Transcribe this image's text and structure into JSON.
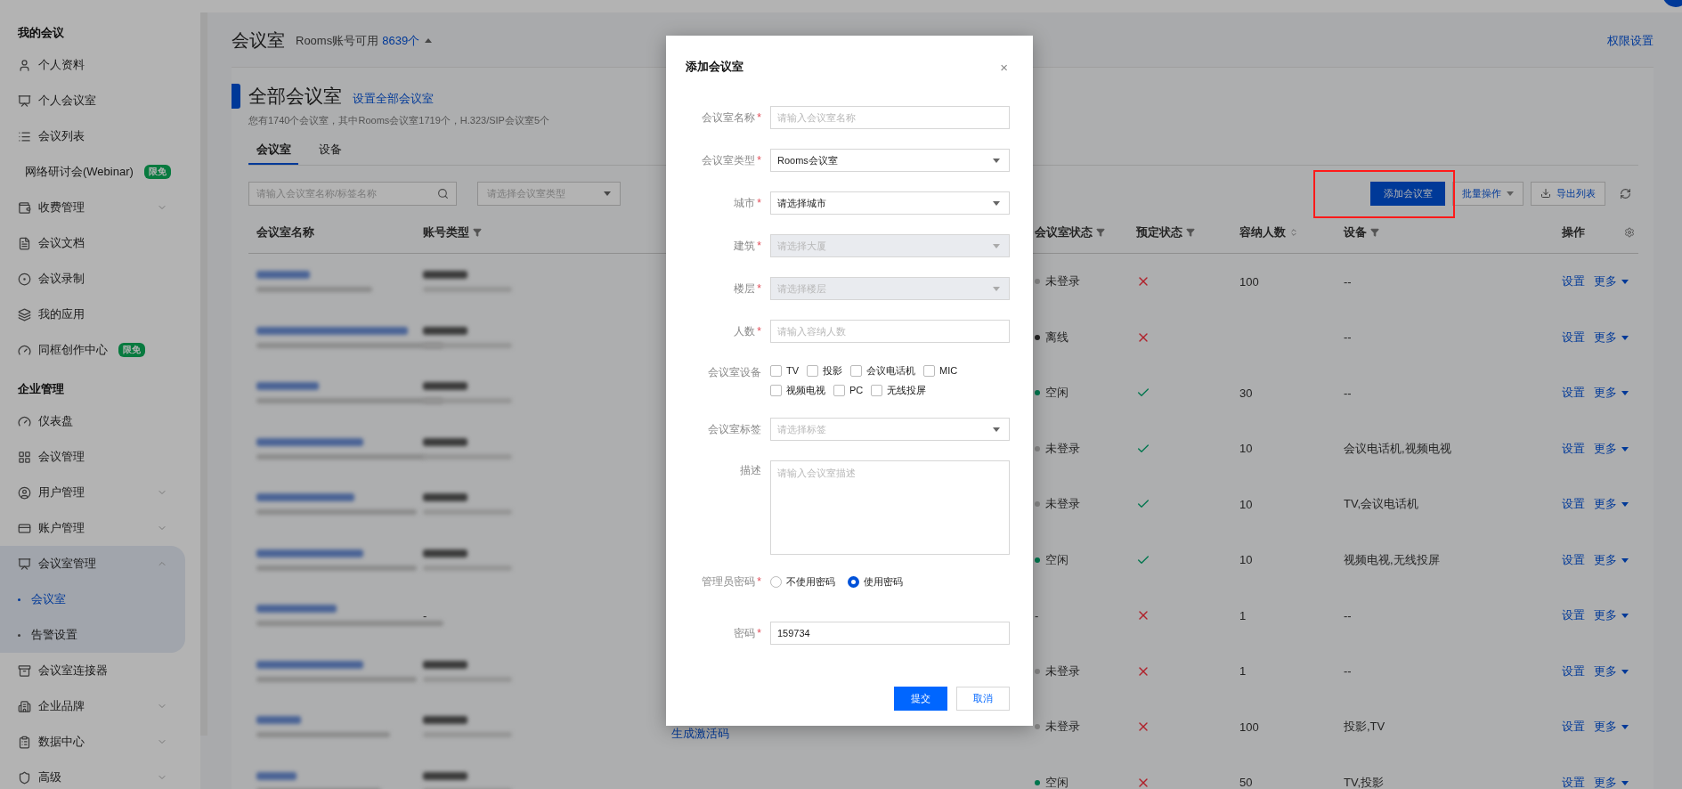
{
  "header": {
    "title": "会议室",
    "quota_label": "Rooms账号可用",
    "quota_value": "8639个",
    "permission_link": "权限设置"
  },
  "sidebar": {
    "sections": [
      {
        "title": "我的会议",
        "items": [
          {
            "label": "个人资料"
          },
          {
            "label": "个人会议室"
          },
          {
            "label": "会议列表"
          },
          {
            "label": "网络研讨会(Webinar)",
            "badge": "限免"
          },
          {
            "label": "收费管理",
            "expanded": false
          },
          {
            "label": "会议文档"
          },
          {
            "label": "会议录制"
          },
          {
            "label": "我的应用"
          },
          {
            "label": "同框创作中心",
            "badge": "限免"
          }
        ]
      },
      {
        "title": "企业管理",
        "items": [
          {
            "label": "仪表盘"
          },
          {
            "label": "会议管理"
          },
          {
            "label": "用户管理",
            "expanded": false
          },
          {
            "label": "账户管理",
            "expanded": false
          },
          {
            "label": "会议室管理",
            "expanded": true,
            "children": [
              {
                "label": "会议室",
                "selected": true
              },
              {
                "label": "告警设置",
                "selected": false
              }
            ]
          },
          {
            "label": "会议室连接器"
          },
          {
            "label": "企业品牌",
            "expanded": false
          },
          {
            "label": "数据中心",
            "expanded": false
          },
          {
            "label": "高级",
            "expanded": false
          }
        ]
      }
    ]
  },
  "card": {
    "title": "全部会议室",
    "link": "设置全部会议室",
    "summary": "您有1740个会议室，其中Rooms会议室1719个，H.323/SIP会议室5个",
    "tabs": [
      {
        "label": "会议室",
        "selected": true
      },
      {
        "label": "设备",
        "selected": false
      }
    ],
    "search": {
      "placeholder": "请输入会议室名称/标签名称"
    },
    "type_select": {
      "placeholder": "请选择会议室类型"
    },
    "add_button": {
      "label": "添加会议室",
      "highlighted": true
    },
    "batch_button": "批量操作",
    "export_button": "导出列表"
  },
  "table": {
    "columns": [
      {
        "label": "会议室名称",
        "kind": "plain"
      },
      {
        "label": "账号类型",
        "kind": "filter"
      },
      {
        "label": "会议室状态",
        "kind": "filter"
      },
      {
        "label": "预定状态",
        "kind": "filter"
      },
      {
        "label": "容纳人数",
        "kind": "sort"
      },
      {
        "label": "设备",
        "kind": "filter"
      },
      {
        "label": "操作",
        "kind": "plain"
      }
    ],
    "rows": [
      {
        "status": "未登录",
        "color": "#868686",
        "booked": false,
        "capacity": "100",
        "devices": "--",
        "actions": [
          "设置",
          "更多"
        ]
      },
      {
        "status": "离线",
        "color": "#242424",
        "booked": false,
        "devices": "--",
        "actions": [
          "设置",
          "更多"
        ]
      },
      {
        "status": "空闲",
        "color": "#00764e",
        "booked": true,
        "capacity": "30",
        "devices": "--",
        "actions": [
          "设置",
          "更多"
        ]
      },
      {
        "status": "未登录",
        "color": "#868686",
        "booked": true,
        "capacity": "10",
        "devices": "会议电话机,视频电视",
        "actions": [
          "设置",
          "更多"
        ]
      },
      {
        "status": "未登录",
        "color": "#868686",
        "booked": true,
        "capacity": "10",
        "devices": "TV,会议电话机",
        "actions": [
          "设置",
          "更多"
        ]
      },
      {
        "status": "空闲",
        "color": "#00764e",
        "booked": true,
        "capacity": "10",
        "devices": "视频电视,无线投屏",
        "actions": [
          "设置",
          "更多"
        ]
      },
      {
        "status": "-",
        "booked": false,
        "capacity": "1",
        "devices": "--",
        "actions": [
          "设置",
          "更多"
        ]
      },
      {
        "status": "未登录",
        "color": "#868686",
        "booked": false,
        "capacity": "1",
        "devices": "--",
        "actions": [
          "设置",
          "更多"
        ]
      },
      {
        "status": "未登录",
        "color": "#868686",
        "booked": false,
        "capacity": "100",
        "devices": "投影,TV",
        "link": "生成激活码",
        "actions": [
          "设置",
          "更多"
        ]
      },
      {
        "status": "空闲",
        "color": "#00764e",
        "booked": false,
        "capacity": "50",
        "devices": "TV,投影",
        "actions": [
          "设置",
          "更多"
        ]
      }
    ]
  },
  "dialog": {
    "title": "添加会议室",
    "close": "×",
    "fields": [
      {
        "kind": "input",
        "label": "会议室名称",
        "required_mark": "*",
        "placeholder": "请输入会议室名称",
        "disabled": false
      },
      {
        "kind": "select",
        "label": "会议室类型",
        "required_mark": "*",
        "value": "Rooms会议室",
        "disabled": false
      },
      {
        "kind": "select",
        "label": "城市",
        "required_mark": "*",
        "value": "请选择城市",
        "disabled": false
      },
      {
        "kind": "select",
        "label": "建筑",
        "required_mark": "*",
        "placeholder": "请选择大厦",
        "disabled": true
      },
      {
        "kind": "select",
        "label": "楼层",
        "required_mark": "*",
        "placeholder": "请选择楼层",
        "disabled": true
      },
      {
        "kind": "input",
        "label": "人数",
        "required_mark": "*",
        "placeholder": "请输入容纳人数",
        "disabled": false
      },
      {
        "kind": "checkboxes",
        "label": "会议室设备",
        "options": [
          {
            "label": "TV",
            "checked": false
          },
          {
            "label": "投影",
            "checked": false
          },
          {
            "label": "会议电话机",
            "checked": false
          },
          {
            "label": "MIC",
            "checked": false
          },
          {
            "label": "视频电视",
            "checked": false
          },
          {
            "label": "PC",
            "checked": false
          },
          {
            "label": "无线投屏",
            "checked": false
          }
        ]
      },
      {
        "kind": "select",
        "label": "会议室标签",
        "placeholder": "请选择标签",
        "disabled": false
      },
      {
        "kind": "textarea",
        "label": "描述",
        "placeholder": "请输入会议室描述"
      },
      {
        "kind": "radios",
        "label": "管理员密码",
        "required_mark": "*",
        "options": [
          {
            "label": "不使用密码",
            "selected": false
          },
          {
            "label": "使用密码",
            "selected": true
          }
        ]
      },
      {
        "kind": "input",
        "label": "密码",
        "required_mark": "*",
        "value": "159734",
        "disabled": false
      }
    ],
    "buttons": [
      {
        "label": "提交",
        "primary": true
      },
      {
        "label": "取消",
        "primary": false
      }
    ]
  }
}
